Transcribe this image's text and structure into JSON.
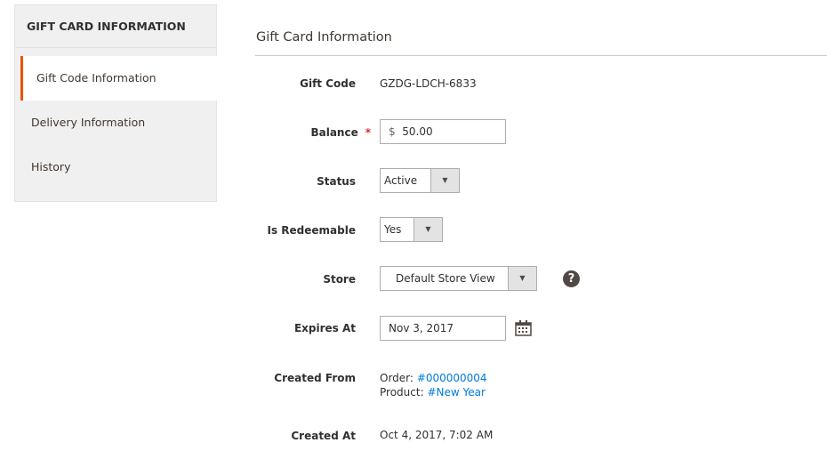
{
  "sidebar": {
    "title": "GIFT CARD INFORMATION",
    "items": [
      {
        "label": "Gift Code Information"
      },
      {
        "label": "Delivery Information"
      },
      {
        "label": "History"
      }
    ]
  },
  "main": {
    "title": "Gift Card Information",
    "gift_code": {
      "label": "Gift Code",
      "value": "GZDG-LDCH-6833"
    },
    "balance": {
      "label": "Balance",
      "required": "*",
      "currency": "$",
      "value": "50.00"
    },
    "status": {
      "label": "Status",
      "value": "Active"
    },
    "redeemable": {
      "label": "Is Redeemable",
      "value": "Yes"
    },
    "store": {
      "label": "Store",
      "value": "Default Store View",
      "help": "?"
    },
    "expires": {
      "label": "Expires At",
      "value": "Nov 3, 2017"
    },
    "created_from": {
      "label": "Created From",
      "order_label": "Order:",
      "order_link": "#000000004",
      "product_label": "Product:",
      "product_link": "#New Year"
    },
    "created_at": {
      "label": "Created At",
      "value": "Oct 4, 2017, 7:02 AM"
    }
  }
}
